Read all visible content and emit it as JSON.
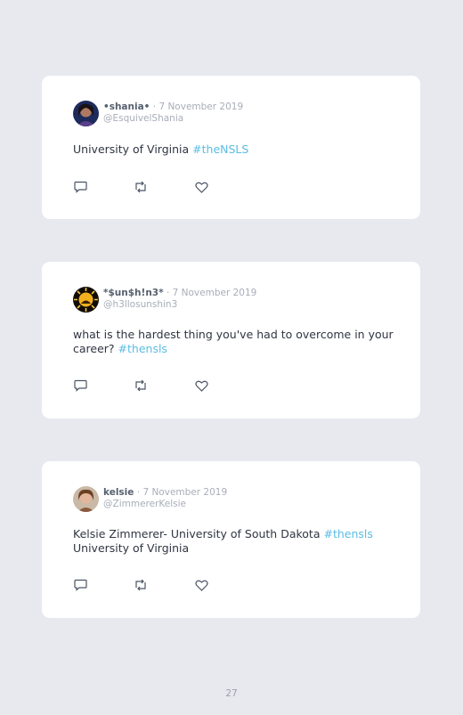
{
  "tweets": [
    {
      "name": "•shania•",
      "date": "7 November 2019",
      "handle": "@EsquivelShania",
      "text": "University of Virginia ",
      "hashtag": "#theNSLS",
      "avatar_icon": "profile-photo"
    },
    {
      "name": "*$un$h!n3*",
      "date": "7 November 2019",
      "handle": "@h3llosunshin3",
      "text": "what is the hardest thing you've had to overcome in your career? ",
      "hashtag": "#thensls",
      "avatar_icon": "sun-photo"
    },
    {
      "name": "kelsie",
      "date": "7 November 2019",
      "handle": "@ZimmererKelsie",
      "text": "Kelsie Zimmerer- University of South Dakota ",
      "hashtag": "#thensls",
      "text_after": "University of Virginia",
      "avatar_icon": "profile-photo"
    }
  ],
  "separator": "·",
  "page_number": "27",
  "colors": {
    "background": "#e8e9ee",
    "card": "#ffffff",
    "hashtag": "#5bbce4",
    "name": "#57606f",
    "muted": "#a8adb8",
    "body_text": "#2f3542"
  },
  "icons": [
    "reply-icon",
    "retweet-icon",
    "like-icon"
  ]
}
